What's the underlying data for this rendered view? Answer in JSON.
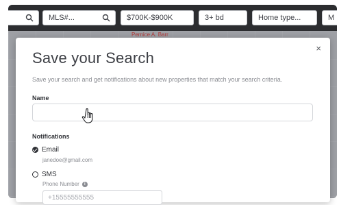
{
  "filters": {
    "search_placeholder": "",
    "mls_placeholder": "MLS#...",
    "price": "$700K-$900K",
    "beds": "3+ bd",
    "home_type": "Home type...",
    "more": "M"
  },
  "map": {
    "street_label": "Pernice A. Barr"
  },
  "modal": {
    "close": "×",
    "title": "Save your Search",
    "description": "Save your search and get notifications about new properties that match your search criteria.",
    "name_label": "Name",
    "name_value": "",
    "notifications_label": "Notifications",
    "email_label": "Email",
    "email_value": "janedoe@gmail.com",
    "email_selected": true,
    "sms_label": "SMS",
    "sms_selected": false,
    "phone_label": "Phone Number",
    "phone_placeholder": "+15555555555"
  },
  "colors": {
    "topbar": "#2c2d30",
    "text": "#2e3035",
    "muted": "#8a8c92"
  }
}
